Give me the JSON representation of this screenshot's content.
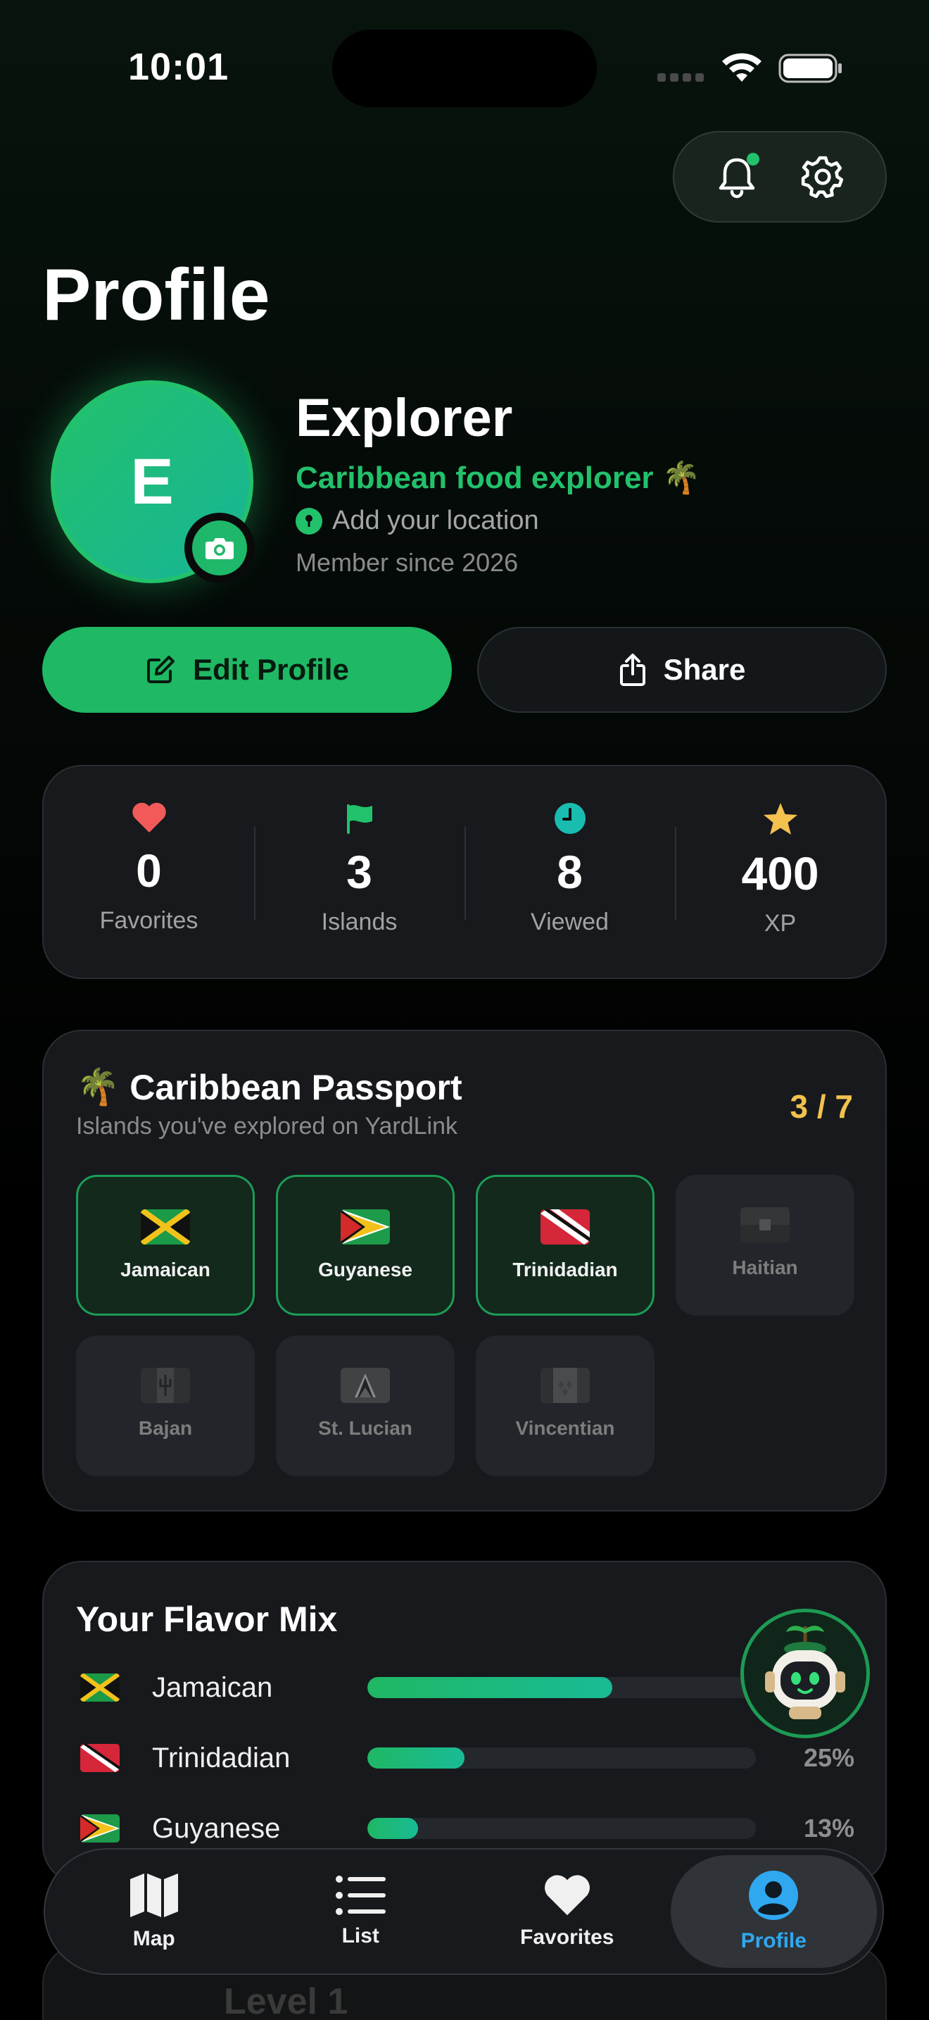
{
  "status_bar": {
    "time": "10:01"
  },
  "header": {
    "title": "Profile"
  },
  "profile": {
    "initial": "E",
    "name": "Explorer",
    "tagline": "Caribbean food explorer 🌴",
    "location": "Add your location",
    "member_since": "Member since 2026"
  },
  "actions": {
    "edit_label": "Edit Profile",
    "share_label": "Share"
  },
  "stats": [
    {
      "value": "0",
      "label": "Favorites",
      "icon": "heart-icon",
      "color": "#f25a5a"
    },
    {
      "value": "3",
      "label": "Islands",
      "icon": "flag-icon",
      "color": "#22c16b"
    },
    {
      "value": "8",
      "label": "Viewed",
      "icon": "clock-icon",
      "color": "#19bdb0"
    },
    {
      "value": "400",
      "label": "XP",
      "icon": "star-icon",
      "color": "#f2c14e"
    }
  ],
  "passport": {
    "emoji": "🌴",
    "title": "Caribbean Passport",
    "subtitle": "Islands you've explored on YardLink",
    "count": "3 / 7",
    "islands": [
      {
        "label": "Jamaican",
        "unlocked": true
      },
      {
        "label": "Guyanese",
        "unlocked": true
      },
      {
        "label": "Trinidadian",
        "unlocked": true
      },
      {
        "label": "Haitian",
        "unlocked": false
      },
      {
        "label": "Bajan",
        "unlocked": false
      },
      {
        "label": "St. Lucian",
        "unlocked": false
      },
      {
        "label": "Vincentian",
        "unlocked": false
      }
    ]
  },
  "flavor_mix": {
    "title": "Your Flavor Mix",
    "rows": [
      {
        "name": "Jamaican",
        "percent": 63,
        "pct_label": ""
      },
      {
        "name": "Trinidadian",
        "percent": 25,
        "pct_label": "25%"
      },
      {
        "name": "Guyanese",
        "percent": 13,
        "pct_label": "13%"
      }
    ]
  },
  "level": {
    "label": "Level 1"
  },
  "tabbar": {
    "tabs": [
      {
        "label": "Map",
        "icon": "map-icon"
      },
      {
        "label": "List",
        "icon": "list-icon"
      },
      {
        "label": "Favorites",
        "icon": "heart-icon"
      },
      {
        "label": "Profile",
        "icon": "profile-icon",
        "active": true
      }
    ]
  },
  "colors": {
    "accent": "#22c16b",
    "gold": "#f2c14e",
    "tab_active": "#2fa8f0"
  }
}
